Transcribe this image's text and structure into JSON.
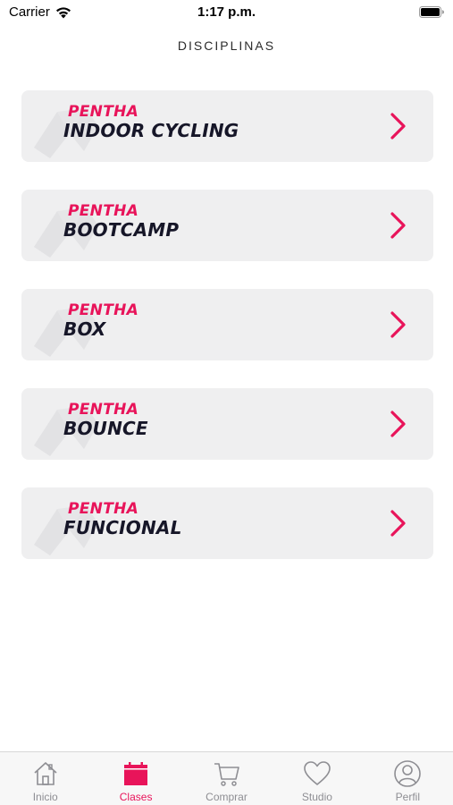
{
  "status_bar": {
    "carrier": "Carrier",
    "time": "1:17 p.m."
  },
  "nav": {
    "title": "DISCIPLINAS"
  },
  "cards": [
    {
      "brand": "PENTHA",
      "title": "INDOOR CYCLING"
    },
    {
      "brand": "PENTHA",
      "title": "BOOTCAMP"
    },
    {
      "brand": "PENTHA",
      "title": "BOX"
    },
    {
      "brand": "PENTHA",
      "title": "BOUNCE"
    },
    {
      "brand": "PENTHA",
      "title": "FUNCIONAL"
    }
  ],
  "tabs": [
    {
      "label": "Inicio",
      "icon": "home-icon",
      "active": false
    },
    {
      "label": "Clases",
      "icon": "calendar-icon",
      "active": true
    },
    {
      "label": "Comprar",
      "icon": "cart-icon",
      "active": false
    },
    {
      "label": "Studio",
      "icon": "heart-icon",
      "active": false
    },
    {
      "label": "Perfil",
      "icon": "profile-icon",
      "active": false
    }
  ],
  "colors": {
    "accent": "#e8145a",
    "title": "#161628",
    "card_bg": "#efeff0",
    "tab_inactive": "#8e8e93"
  }
}
